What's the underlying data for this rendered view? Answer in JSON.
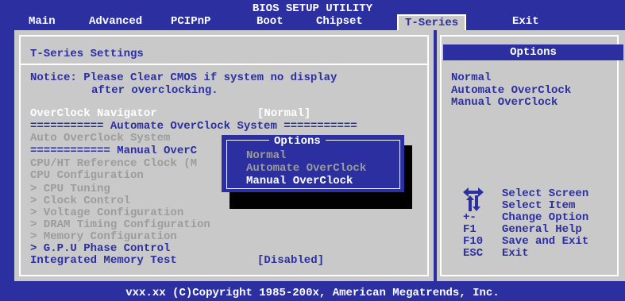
{
  "header": {
    "title": "BIOS SETUP UTILITY",
    "tabs": [
      "Main",
      "Advanced",
      "PCIPnP",
      "Boot",
      "Chipset",
      "T-Series",
      "Exit"
    ],
    "active_tab": "T-Series"
  },
  "main": {
    "section_title": "T-Series Settings",
    "notice_line1": "Notice: Please Clear CMOS if system no display",
    "notice_line2": "after overclocking.",
    "overclock_navigator_label": "OverClock Navigator",
    "overclock_navigator_value": "[Normal]",
    "auto_header": "=========== Automate OverClock System ===========",
    "auto_system": "Auto OverClock System",
    "manual_header": "============ Manual OverC",
    "cpu_ht_ref": "CPU/HT Reference Clock (M",
    "cpu_config": "CPU Configuration",
    "cpu_tuning": "> CPU Tuning",
    "clock_control": "> Clock Control",
    "voltage_config": "> Voltage Configuration",
    "dram_timing": "> DRAM Timing Configuration",
    "memory_config": "> Memory Configuration",
    "gpu_phase": "> G.P.U Phase Control",
    "integrated_memory_test_label": "Integrated Memory Test",
    "integrated_memory_test_value": "[Disabled]"
  },
  "side": {
    "title": "Options",
    "options": [
      "Normal",
      "Automate OverClock",
      "Manual OverClock"
    ],
    "help": [
      {
        "key": "",
        "text": "Select Screen",
        "icon": "left-right-arrows-icon"
      },
      {
        "key": "",
        "text": "Select Item",
        "icon": "up-down-arrows-icon"
      },
      {
        "key": "+-",
        "text": "Change Option"
      },
      {
        "key": "F1",
        "text": "General Help"
      },
      {
        "key": "F10",
        "text": "Save and Exit"
      },
      {
        "key": "ESC",
        "text": "Exit"
      }
    ]
  },
  "popup": {
    "title": "Options",
    "items": [
      "Normal",
      "Automate OverClock",
      "Manual OverClock"
    ],
    "selected_index": 2
  },
  "footer": {
    "copyright": "vxx.xx (C)Copyright 1985-200x, American Megatrends, Inc."
  },
  "colors": {
    "bios_blue": "#2b2fa0",
    "panel_gray": "#c9c9c9",
    "highlight_white": "#ffffff"
  }
}
